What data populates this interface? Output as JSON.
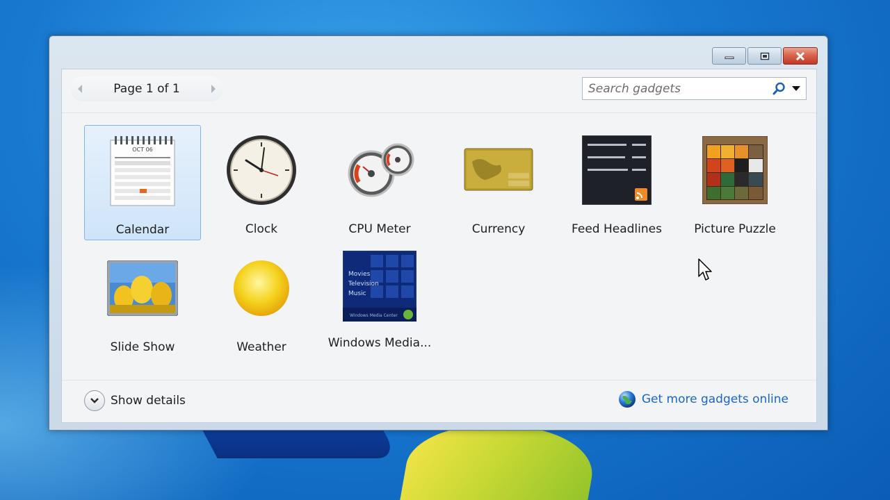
{
  "window": {
    "caption_buttons": {
      "minimize": "minimize-icon",
      "maximize": "maximize-icon",
      "close": "close-icon"
    }
  },
  "pager": {
    "text": "Page 1 of 1",
    "prev_icon": "chevron-left-icon",
    "next_icon": "chevron-right-icon"
  },
  "search": {
    "placeholder": "Search gadgets",
    "value": ""
  },
  "gadgets": [
    {
      "label": "Calendar",
      "selected": true,
      "icon": "calendar-icon"
    },
    {
      "label": "Clock",
      "selected": false,
      "icon": "clock-icon"
    },
    {
      "label": "CPU Meter",
      "selected": false,
      "icon": "cpu-meter-icon"
    },
    {
      "label": "Currency",
      "selected": false,
      "icon": "currency-icon"
    },
    {
      "label": "Feed Headlines",
      "selected": false,
      "icon": "feed-headlines-icon"
    },
    {
      "label": "Picture Puzzle",
      "selected": false,
      "icon": "picture-puzzle-icon"
    },
    {
      "label": "Slide Show",
      "selected": false,
      "icon": "slide-show-icon"
    },
    {
      "label": "Weather",
      "selected": false,
      "icon": "weather-icon"
    },
    {
      "label": "Windows Media...",
      "selected": false,
      "icon": "windows-media-center-icon"
    }
  ],
  "thumb_text": {
    "calendar_month": "OCT 06",
    "media_items": [
      "Movies",
      "Television",
      "Music"
    ],
    "media_footer": "Windows Media Center"
  },
  "footer": {
    "details_label": "Show details",
    "online_link": "Get more gadgets online"
  },
  "colors": {
    "accent": "#1a66c8",
    "selection": "#cfe4f9",
    "close": "#c2382a"
  }
}
